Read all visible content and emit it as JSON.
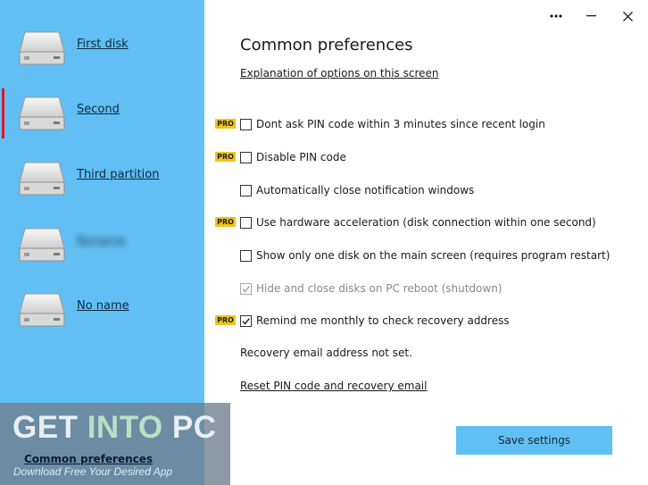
{
  "sidebar": {
    "disks": [
      {
        "label": "First disk",
        "selected": false,
        "blurred": false
      },
      {
        "label": "Second",
        "selected": true,
        "blurred": false
      },
      {
        "label": "Third partition",
        "selected": false,
        "blurred": false
      },
      {
        "label": "Noname",
        "selected": false,
        "blurred": true
      },
      {
        "label": "No name",
        "selected": false,
        "blurred": false
      }
    ],
    "common_preferences_link": "Common preferences"
  },
  "watermark": {
    "get": "GET ",
    "into": "INTO",
    "pc": " PC",
    "subtitle": "Download Free Your Desired App"
  },
  "window_controls": {
    "more": "•••",
    "minimize": "—",
    "close": "✕"
  },
  "main": {
    "title": "Common preferences",
    "explanation_link": "Explanation of options on this screen",
    "options": [
      {
        "label": "Dont ask PIN code within 3 minutes since recent login",
        "pro": true,
        "checked": false,
        "disabled": false
      },
      {
        "label": "Disable PIN code",
        "pro": true,
        "checked": false,
        "disabled": false
      },
      {
        "label": "Automatically close notification windows",
        "pro": false,
        "checked": false,
        "disabled": false
      },
      {
        "label": "Use hardware acceleration (disk connection within one second)",
        "pro": true,
        "checked": false,
        "disabled": false
      },
      {
        "label": "Show only one disk on the main screen (requires program restart)",
        "pro": false,
        "checked": false,
        "disabled": false
      },
      {
        "label": "Hide and close disks on PC reboot (shutdown)",
        "pro": false,
        "checked": true,
        "disabled": true
      },
      {
        "label": "Remind me monthly to check recovery address",
        "pro": true,
        "checked": true,
        "disabled": false
      }
    ],
    "pro_badge": "PRO",
    "recovery_status": "Recovery email address not set.",
    "reset_link": "Reset PIN code and recovery email",
    "save_button": "Save settings"
  },
  "colors": {
    "sidebar_bg": "#61bff3",
    "selection_indicator": "#e81123",
    "pro_badge": "#f0c419",
    "save_button": "#61bff3"
  }
}
